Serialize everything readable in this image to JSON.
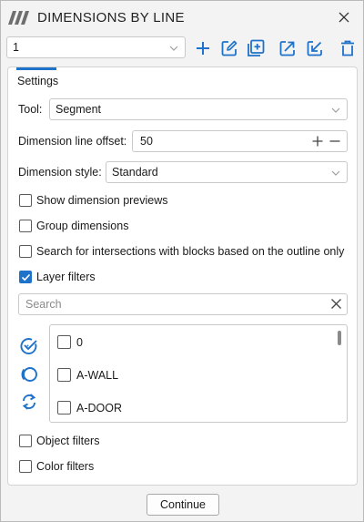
{
  "window": {
    "title": "DIMENSIONS BY LINE"
  },
  "toolbar": {
    "preset_value": "1",
    "icons": [
      "plus-icon",
      "edit-icon",
      "duplicate-icon",
      "export-icon",
      "import-icon",
      "trash-icon"
    ]
  },
  "tab": {
    "label": "Settings"
  },
  "settings": {
    "tool_label": "Tool:",
    "tool_value": "Segment",
    "offset_label": "Dimension line offset:",
    "offset_value": "50",
    "style_label": "Dimension style:",
    "style_value": "Standard"
  },
  "options": [
    {
      "label": "Show dimension previews",
      "checked": false
    },
    {
      "label": "Group dimensions",
      "checked": false
    },
    {
      "label": "Search for intersections with blocks based on the outline only",
      "checked": false
    },
    {
      "label": "Layer filters",
      "checked": true
    }
  ],
  "search": {
    "placeholder": "Search"
  },
  "layers": [
    {
      "name": "0",
      "checked": false
    },
    {
      "name": "A-WALL",
      "checked": false
    },
    {
      "name": "A-DOOR",
      "checked": false
    }
  ],
  "filters": [
    {
      "label": "Object filters",
      "checked": false
    },
    {
      "label": "Color filters",
      "checked": false
    }
  ],
  "footer": {
    "continue_label": "Continue"
  },
  "colors": {
    "accent": "#1f72c9",
    "border": "#c9c9c9"
  }
}
